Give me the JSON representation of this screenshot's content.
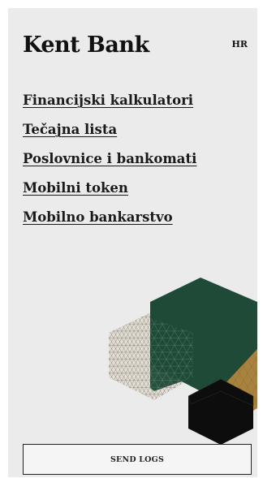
{
  "header": {
    "logo_text": "Kent Bank",
    "language": "HR"
  },
  "menu": {
    "items": [
      {
        "label": "Financijski kalkulatori"
      },
      {
        "label": "Tečajna lista"
      },
      {
        "label": "Poslovnice i bankomati"
      },
      {
        "label": "Mobilni token"
      },
      {
        "label": "Mobilno bankarstvo"
      }
    ]
  },
  "footer": {
    "send_logs_label": "SEND LOGS"
  },
  "colors": {
    "background": "#ebebeb",
    "hex_green": "#1f4a38",
    "hex_gold": "#b08a44",
    "hex_black": "#0d0d0d",
    "hex_pattern": "#e0dbd2"
  },
  "icons": {
    "decoration": "hexagon-pattern-illustration"
  }
}
